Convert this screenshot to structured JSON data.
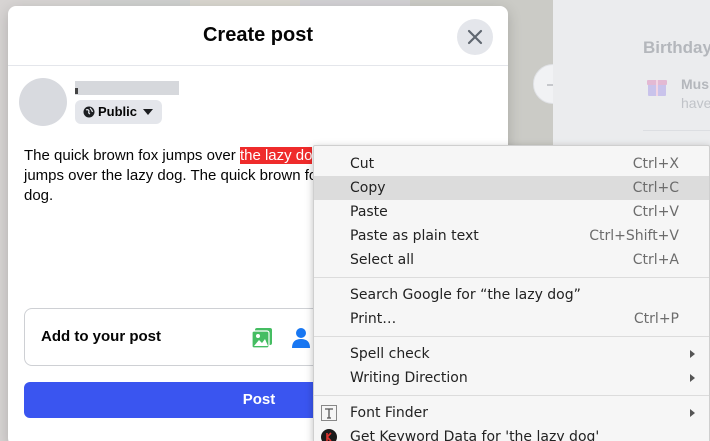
{
  "background": {
    "birthdays_title": "Birthday",
    "birthday_name": "Mus",
    "birthday_note": "have"
  },
  "dialog": {
    "title": "Create post",
    "audience": {
      "label": "Public"
    },
    "post_text": {
      "before_selection": "The quick brown fox jumps over ",
      "selected": "the lazy do",
      "after_selection": "jumps over the lazy dog. The quick brown fo",
      "last_line": "dog."
    },
    "add_to_post": {
      "label": "Add to your post"
    },
    "post_button": {
      "label": "Post"
    }
  },
  "context_menu": {
    "groups": [
      [
        {
          "label": "Cut",
          "shortcut": "Ctrl+X"
        },
        {
          "label": "Copy",
          "shortcut": "Ctrl+C",
          "highlighted": true
        },
        {
          "label": "Paste",
          "shortcut": "Ctrl+V"
        },
        {
          "label": "Paste as plain text",
          "shortcut": "Ctrl+Shift+V"
        },
        {
          "label": "Select all",
          "shortcut": "Ctrl+A"
        }
      ],
      [
        {
          "label": "Search Google for “the lazy dog”",
          "shortcut": ""
        },
        {
          "label": "Print…",
          "shortcut": "Ctrl+P"
        }
      ],
      [
        {
          "label": "Spell check",
          "submenu": true
        },
        {
          "label": "Writing Direction",
          "submenu": true
        }
      ],
      [
        {
          "label": "Font Finder",
          "submenu": true,
          "icon": "font-finder-icon"
        },
        {
          "label": "Get Keyword Data for 'the lazy dog'",
          "icon": "keywords-everywhere-icon"
        }
      ]
    ]
  },
  "colors": {
    "accent": "#3a55f0",
    "selection": "#ef2b2b",
    "menu_background": "#f6f6f6",
    "menu_highlight": "#dcdcdc"
  }
}
